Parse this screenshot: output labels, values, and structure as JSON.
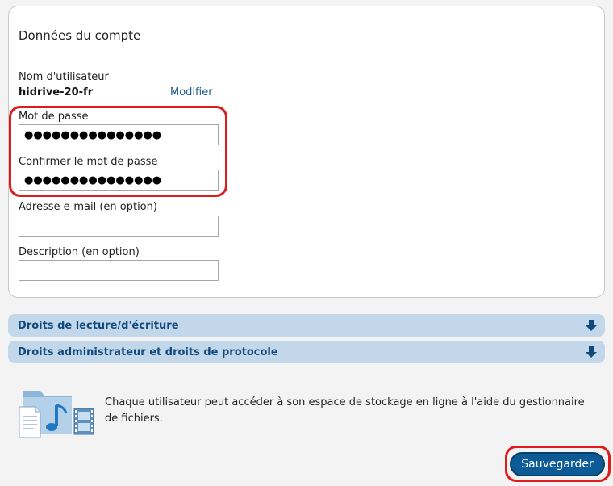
{
  "account": {
    "title": "Données du compte",
    "username_label": "Nom d'utilisateur",
    "username": "hidrive-20-fr",
    "modify_link": "Modifier",
    "password_label": "Mot de passe",
    "password_value": "●●●●●●●●●●●●●●●",
    "confirm_label": "Confirmer le mot de passe",
    "confirm_value": "●●●●●●●●●●●●●●●",
    "email_label": "Adresse e-mail (en option)",
    "email_value": "",
    "description_label": "Description (en option)",
    "description_value": ""
  },
  "sections": [
    {
      "label": "Droits de lecture/d'écriture",
      "icon": "arrow-down-icon"
    },
    {
      "label": "Droits administrateur et droits de protocole",
      "icon": "arrow-down-icon"
    }
  ],
  "info": {
    "text": "Chaque utilisateur peut accéder à son espace de stockage en ligne à l'aide du gestionnaire de fichiers.",
    "icon": "folder-files-icon"
  },
  "save_button": "Sauvegarder",
  "colors": {
    "accent": "#0c5a96",
    "section_bar": "#c2d8ea",
    "highlight": "#e01b1b",
    "link": "#1b5a8f"
  }
}
